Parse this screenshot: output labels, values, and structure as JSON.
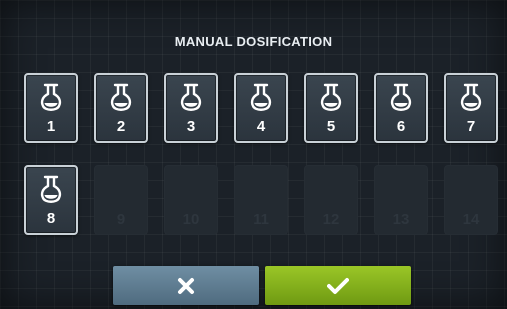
{
  "screen": {
    "title": "MANUAL DOSIFICATION"
  },
  "tiles": [
    {
      "label": "1",
      "enabled": true,
      "icon": "flask-icon"
    },
    {
      "label": "2",
      "enabled": true,
      "icon": "flask-icon"
    },
    {
      "label": "3",
      "enabled": true,
      "icon": "flask-icon"
    },
    {
      "label": "4",
      "enabled": true,
      "icon": "flask-icon"
    },
    {
      "label": "5",
      "enabled": true,
      "icon": "flask-icon"
    },
    {
      "label": "6",
      "enabled": true,
      "icon": "flask-icon"
    },
    {
      "label": "7",
      "enabled": true,
      "icon": "flask-icon"
    },
    {
      "label": "8",
      "enabled": true,
      "icon": "flask-icon"
    },
    {
      "label": "9",
      "enabled": false
    },
    {
      "label": "10",
      "enabled": false
    },
    {
      "label": "11",
      "enabled": false
    },
    {
      "label": "12",
      "enabled": false
    },
    {
      "label": "13",
      "enabled": false
    },
    {
      "label": "14",
      "enabled": false
    }
  ],
  "buttons": {
    "cancel": {
      "icon": "close-icon",
      "color": "#5f7c90"
    },
    "confirm": {
      "icon": "checkmark-icon",
      "color": "#86b01c"
    }
  }
}
